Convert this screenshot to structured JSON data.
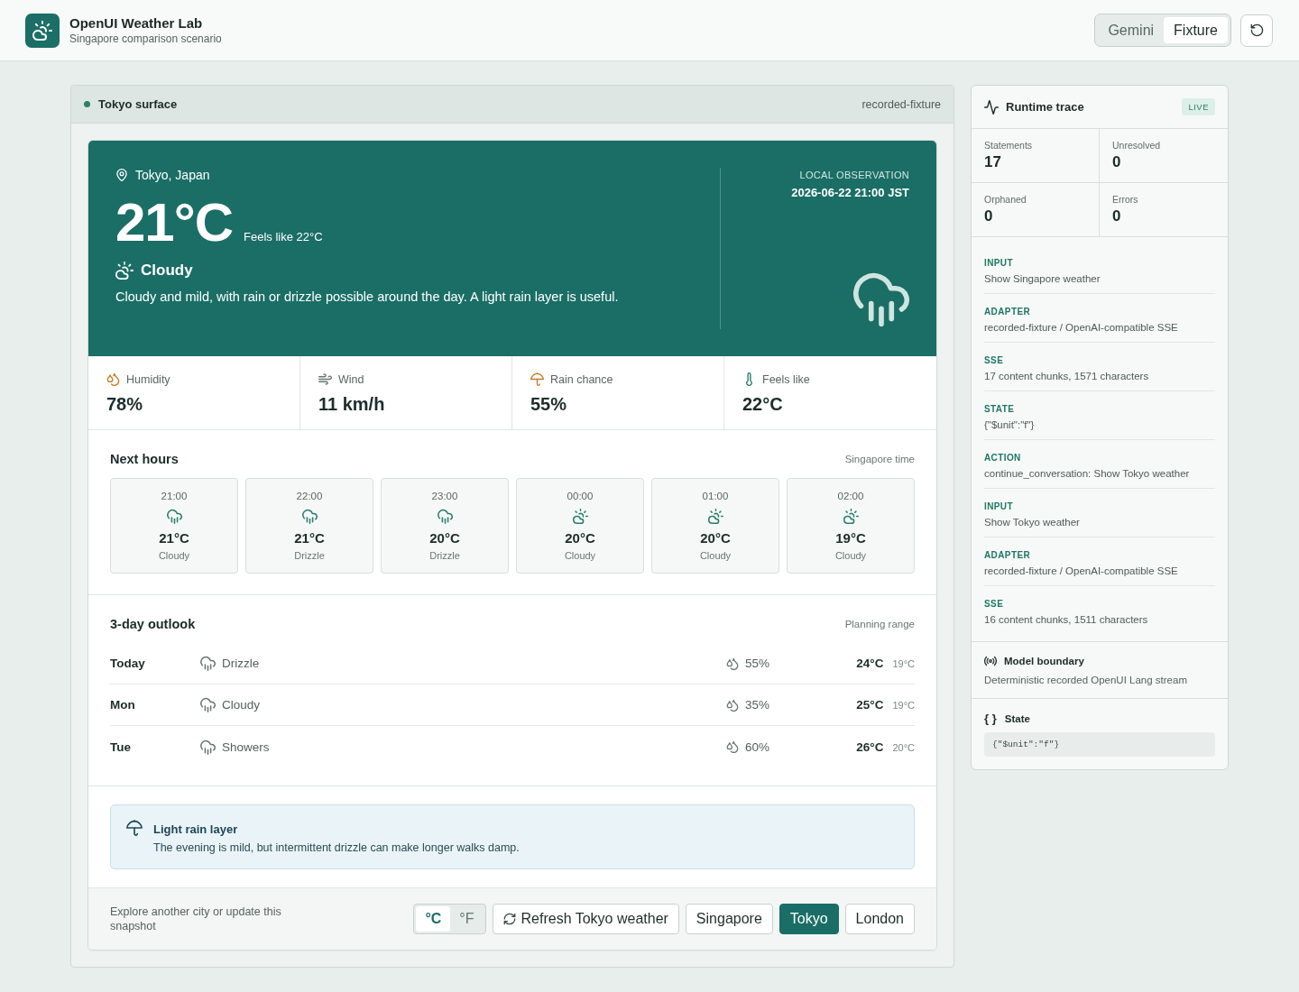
{
  "header": {
    "title": "OpenUI Weather Lab",
    "subtitle": "Singapore comparison scenario",
    "source_toggle": [
      {
        "label": "Gemini",
        "selected": false
      },
      {
        "label": "Fixture",
        "selected": true
      }
    ]
  },
  "surface": {
    "title": "Tokyo surface",
    "source": "recorded-fixture"
  },
  "current": {
    "location": "Tokyo, Japan",
    "temperature": "21°C",
    "feels_like": "Feels like 22°C",
    "condition": "Cloudy",
    "summary": "Cloudy and mild, with rain or drizzle possible around the day. A light rain layer is useful.",
    "observation_label": "LOCAL OBSERVATION",
    "observation_time": "2026-06-22 21:00 JST"
  },
  "metrics": [
    {
      "kind": "humidity",
      "label": "Humidity",
      "value": "78%"
    },
    {
      "kind": "wind",
      "label": "Wind",
      "value": "11 km/h"
    },
    {
      "kind": "rain_chance",
      "label": "Rain chance",
      "value": "55%"
    },
    {
      "kind": "feels_like",
      "label": "Feels like",
      "value": "22°C"
    }
  ],
  "next_hours": {
    "title": "Next hours",
    "note": "Singapore time",
    "hours": [
      {
        "time": "21:00",
        "kind": "rain",
        "temperature": "21°C",
        "condition": "Cloudy"
      },
      {
        "time": "22:00",
        "kind": "rain",
        "temperature": "21°C",
        "condition": "Drizzle"
      },
      {
        "time": "23:00",
        "kind": "rain",
        "temperature": "20°C",
        "condition": "Drizzle"
      },
      {
        "time": "00:00",
        "kind": "partly_cloudy",
        "temperature": "20°C",
        "condition": "Cloudy"
      },
      {
        "time": "01:00",
        "kind": "partly_cloudy",
        "temperature": "20°C",
        "condition": "Cloudy"
      },
      {
        "time": "02:00",
        "kind": "partly_cloudy",
        "temperature": "19°C",
        "condition": "Cloudy"
      }
    ]
  },
  "outlook": {
    "title": "3-day outlook",
    "note": "Planning range",
    "days": [
      {
        "day": "Today",
        "condition": "Drizzle",
        "rain_chance": "55%",
        "high": "24°C",
        "low": "19°C"
      },
      {
        "day": "Mon",
        "condition": "Cloudy",
        "rain_chance": "35%",
        "high": "25°C",
        "low": "19°C"
      },
      {
        "day": "Tue",
        "condition": "Showers",
        "rain_chance": "60%",
        "high": "26°C",
        "low": "20°C"
      }
    ]
  },
  "advice": {
    "title": "Light rain layer",
    "text": "The evening is mild, but intermittent drizzle can make longer walks damp."
  },
  "footer": {
    "prompt": "Explore another city or update this snapshot",
    "units": [
      {
        "label": "°C",
        "selected": true
      },
      {
        "label": "°F",
        "selected": false
      }
    ],
    "refresh": "Refresh Tokyo weather",
    "cities": [
      {
        "label": "Singapore",
        "selected": false
      },
      {
        "label": "Tokyo",
        "selected": true
      },
      {
        "label": "London",
        "selected": false
      }
    ]
  },
  "trace": {
    "title": "Runtime trace",
    "badge": "LIVE",
    "stats": [
      {
        "label": "Statements",
        "value": "17"
      },
      {
        "label": "Unresolved",
        "value": "0"
      },
      {
        "label": "Orphaned",
        "value": "0"
      },
      {
        "label": "Errors",
        "value": "0"
      }
    ],
    "events": [
      {
        "type": "INPUT",
        "detail": "Show Singapore weather"
      },
      {
        "type": "ADAPTER",
        "detail": "recorded-fixture / OpenAI-compatible SSE"
      },
      {
        "type": "SSE",
        "detail": "17 content chunks, 1571 characters"
      },
      {
        "type": "STATE",
        "detail": "{\"$unit\":\"f\"}"
      },
      {
        "type": "ACTION",
        "detail": "continue_conversation: Show Tokyo weather"
      },
      {
        "type": "INPUT",
        "detail": "Show Tokyo weather"
      },
      {
        "type": "ADAPTER",
        "detail": "recorded-fixture / OpenAI-compatible SSE"
      },
      {
        "type": "SSE",
        "detail": "16 content chunks, 1511 characters"
      }
    ],
    "model_boundary": {
      "title": "Model boundary",
      "text": "Deterministic recorded OpenUI Lang stream"
    },
    "state": {
      "glyph": "{ }",
      "title": "State",
      "value": "{\"$unit\":\"f\"}"
    }
  }
}
